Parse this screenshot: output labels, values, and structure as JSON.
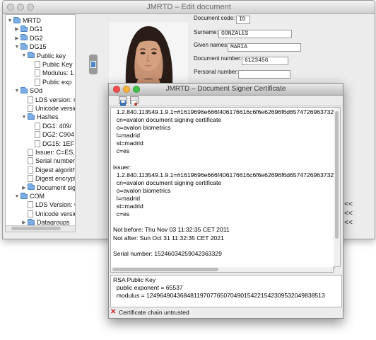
{
  "main_window": {
    "title": "JMRTD – Edit document",
    "tree": [
      {
        "label": "MRTD",
        "type": "folder",
        "expanded": true
      },
      {
        "label": "DG1",
        "type": "folder",
        "expanded": false
      },
      {
        "label": "DG2",
        "type": "folder",
        "expanded": false
      },
      {
        "label": "DG15",
        "type": "folder",
        "expanded": true
      },
      {
        "label": "Public key",
        "type": "folder",
        "expanded": true
      },
      {
        "label": "Public Key",
        "type": "file"
      },
      {
        "label": "Modulus: 1",
        "type": "file"
      },
      {
        "label": "Public exp",
        "type": "file"
      },
      {
        "label": "SOd",
        "type": "folder",
        "expanded": true
      },
      {
        "label": "LDS version: n",
        "type": "file"
      },
      {
        "label": "Unicode versio",
        "type": "file"
      },
      {
        "label": "Hashes",
        "type": "folder",
        "expanded": true
      },
      {
        "label": "DG1: 409/",
        "type": "file"
      },
      {
        "label": "DG2: C904",
        "type": "file"
      },
      {
        "label": "DG15: 1EF",
        "type": "file"
      },
      {
        "label": "Issuer: C=ES,",
        "type": "file"
      },
      {
        "label": "Serial number",
        "type": "file"
      },
      {
        "label": "Digest algorith",
        "type": "file"
      },
      {
        "label": "Digest encrypt",
        "type": "file"
      },
      {
        "label": "Document sign",
        "type": "folder",
        "expanded": false
      },
      {
        "label": "COM",
        "type": "folder",
        "expanded": true
      },
      {
        "label": "LDS Version: C",
        "type": "file"
      },
      {
        "label": "Unicode versio",
        "type": "file"
      },
      {
        "label": "Datagroups",
        "type": "folder",
        "expanded": false
      }
    ],
    "fields": [
      {
        "label": "Document code:",
        "value": "ID"
      },
      {
        "label": "Surname:",
        "value": "GONZALES"
      },
      {
        "label": "Given names:",
        "value": "MARIA"
      },
      {
        "label": "Document number:",
        "value": "6123456"
      },
      {
        "label": "Personal number:",
        "value": ""
      }
    ],
    "arrows": [
      "<<",
      "<<",
      "<<"
    ]
  },
  "dialog": {
    "title": "JMRTD – Document Signer Certificate",
    "subject_lines": [
      "1.2.840.113549.1.9.1=#1619696e666f406176616c6f6e62696f6d6574726963732e636f6d",
      "cn=avalon document signing certificate",
      "o=avalon biometrics",
      "l=madrid",
      "st=madrid",
      "c=es"
    ],
    "issuer_label": "issuer:",
    "issuer_lines": [
      "1.2.840.113549.1.9.1=#1619696e666f406176616c6f6e62696f6d6574726963732e636f6d",
      "cn=avalon document signing certificate",
      "o=avalon biometrics",
      "l=madrid",
      "st=madrid",
      "c=es"
    ],
    "not_before": "Not before: Thu Nov 03 11:32:35 CET 2011",
    "not_after": "Not after: Sun Oct 31 11:32:35 CET 2021",
    "serial": "Serial number: 1524603425904236332​9",
    "key_title": "RSA Public Key",
    "public_exponent": "  public exponent = 65537",
    "modulus": "  modulus = 12496490436848119707765070490154221542309532049838513",
    "status": "Certificate chain untrusted",
    "colors": {
      "close": "#f04c4c",
      "minimize": "#f5b53a",
      "maximize": "#45c04a",
      "error": "#d21d1d"
    }
  }
}
